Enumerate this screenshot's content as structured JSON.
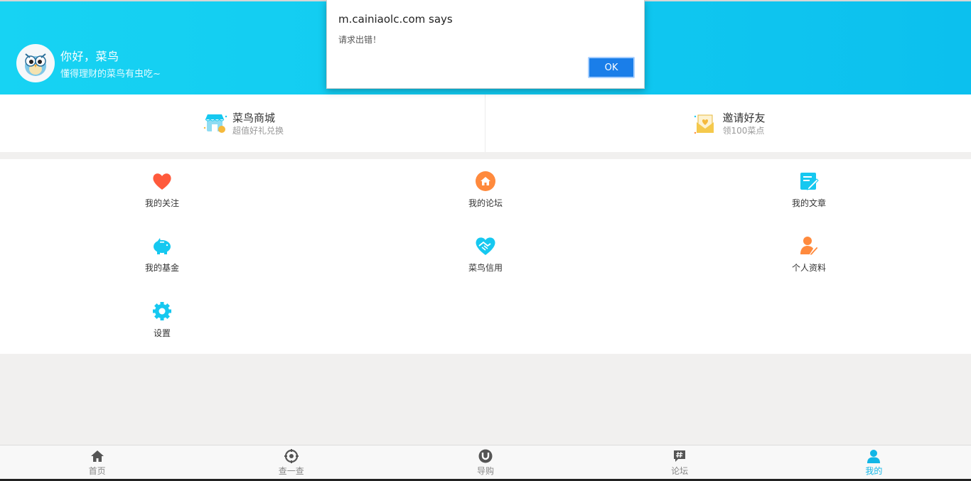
{
  "profile": {
    "greeting": "你好，菜鸟",
    "motto": "懂得理财的菜鸟有虫吃~"
  },
  "quick_links": [
    {
      "title": "菜鸟商城",
      "subtitle": "超值好礼兑换",
      "icon": "shop-icon"
    },
    {
      "title": "邀请好友",
      "subtitle": "领100菜点",
      "icon": "invite-envelope-icon"
    }
  ],
  "grid": [
    {
      "label": "我的关注",
      "icon": "heart-icon",
      "color": "#ff5a3c"
    },
    {
      "label": "我的论坛",
      "icon": "home-icon",
      "color": "#ff8a3d"
    },
    {
      "label": "我的文章",
      "icon": "edit-article-icon",
      "color": "#16c8f0"
    },
    {
      "label": "我的基金",
      "icon": "piggy-bank-icon",
      "color": "#16c8f0"
    },
    {
      "label": "菜鸟信用",
      "icon": "handshake-icon",
      "color": "#16c8f0"
    },
    {
      "label": "个人资料",
      "icon": "user-edit-icon",
      "color": "#ff8a3d"
    },
    {
      "label": "设置",
      "icon": "gear-icon",
      "color": "#16c8f0"
    }
  ],
  "tabbar": [
    {
      "label": "首页",
      "icon": "home-icon",
      "active": false
    },
    {
      "label": "查一查",
      "icon": "target-icon",
      "active": false
    },
    {
      "label": "导购",
      "icon": "magnet-icon",
      "active": false
    },
    {
      "label": "论坛",
      "icon": "hash-chat-icon",
      "active": false
    },
    {
      "label": "我的",
      "icon": "user-icon",
      "active": true
    }
  ],
  "dialog": {
    "title": "m.cainiaolc.com says",
    "message": "请求出错！",
    "ok_label": "OK"
  },
  "colors": {
    "header": "#10c8f0",
    "accent": "#12b6e6",
    "ok_button": "#1a7ee9"
  }
}
